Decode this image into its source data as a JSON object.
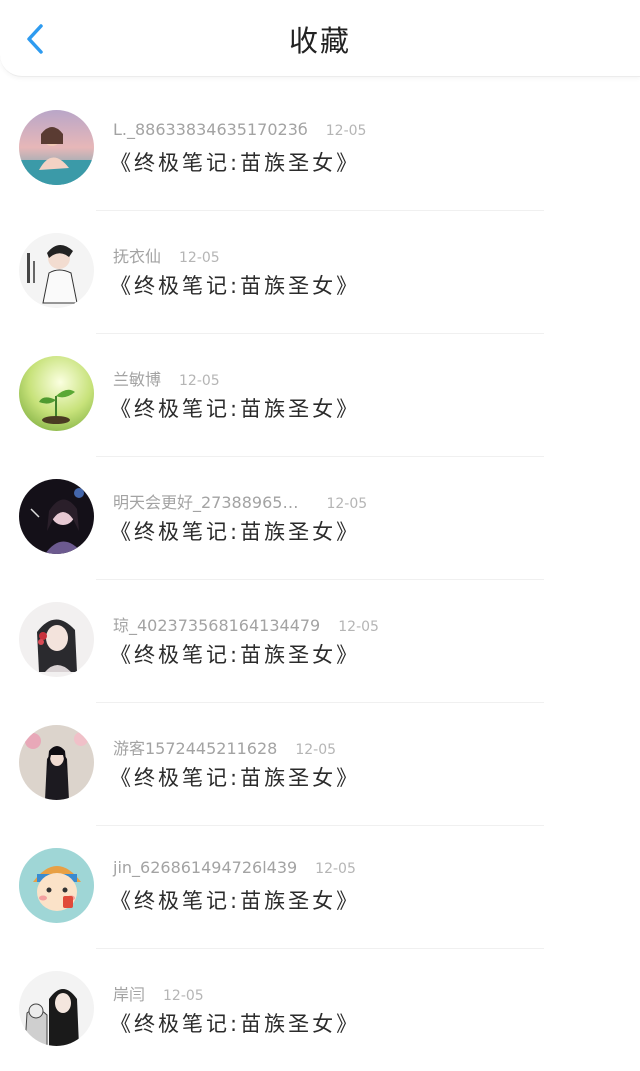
{
  "header": {
    "title": "收藏"
  },
  "items": [
    {
      "user": "L._8863383463517023б",
      "date": "12-05",
      "book": "《终极笔记:苗族圣女》"
    },
    {
      "user": "抚衣仙",
      "date": "12-05",
      "book": "《终极笔记:苗族圣女》"
    },
    {
      "user": "兰敏博",
      "date": "12-05",
      "book": "《终极笔记:苗族圣女》"
    },
    {
      "user": "明天会更好_27388965…",
      "date": "12-05",
      "book": "《终极笔记:苗族圣女》"
    },
    {
      "user": "琼_402373568164134479",
      "date": "12-05",
      "book": "《终极笔记:苗族圣女》"
    },
    {
      "user": "游客1572445211628",
      "date": "12-05",
      "book": "《终极笔记:苗族圣女》"
    },
    {
      "user": "jin_626861494726l439",
      "date": "12-05",
      "book": "《终极笔记:苗族圣女》"
    },
    {
      "user": "岸闫",
      "date": "12-05",
      "book": "《终极笔记:苗族圣女》"
    }
  ],
  "colors": {
    "accent": "#2e9bf0"
  },
  "icons": {
    "back": "chevron-left-icon"
  }
}
